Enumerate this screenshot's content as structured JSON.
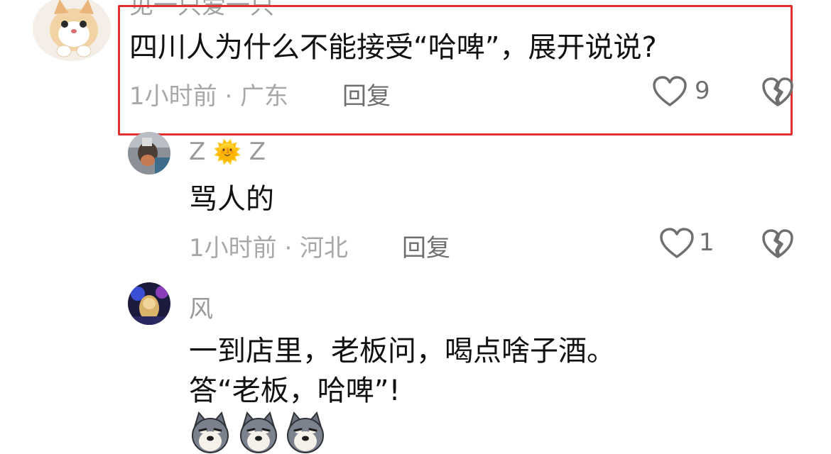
{
  "highlight_color": "#e1302f",
  "comments": [
    {
      "username": "见一只爱一只",
      "avatar_icon": "cat-avatar-icon",
      "content": "四川人为什么不能接受“哈啤”，展开说说?",
      "time_location": "1小时前 · 广东",
      "reply_label": "回复",
      "likes": "9"
    },
    {
      "username_prefix": "Z",
      "username_emoji": "🌞",
      "username_suffix": "Z",
      "avatar_icon": "photo-avatar-icon",
      "content": "骂人的",
      "time_location": "1小时前 · 河北",
      "reply_label": "回复",
      "likes": "1"
    },
    {
      "username": "风",
      "avatar_icon": "character-avatar-icon",
      "content_line1": "一到店里，老板问，喝点啥子酒。",
      "content_line2": "答“老板，哈啤”!",
      "stickers": [
        "dog-emoji-icon",
        "dog-emoji-icon",
        "dog-emoji-icon"
      ]
    }
  ]
}
